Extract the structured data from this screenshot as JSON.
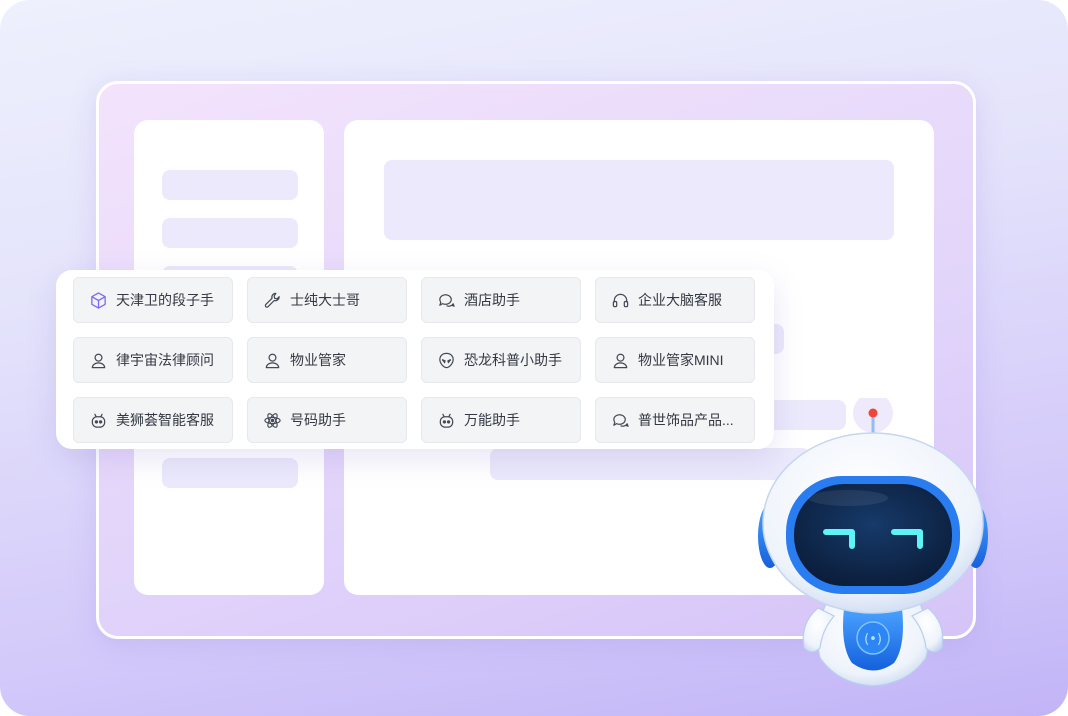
{
  "menu": {
    "items": [
      {
        "label": "天津卫的段子手",
        "icon": "cube-icon"
      },
      {
        "label": "士纯大士哥",
        "icon": "wrench-icon"
      },
      {
        "label": "酒店助手",
        "icon": "chat-bubbles-icon"
      },
      {
        "label": "企业大脑客服",
        "icon": "headset-icon"
      },
      {
        "label": "律宇宙法律顾问",
        "icon": "person-icon"
      },
      {
        "label": "物业管家",
        "icon": "person-icon"
      },
      {
        "label": "恐龙科普小助手",
        "icon": "alien-icon"
      },
      {
        "label": "物业管家MINI",
        "icon": "person-icon"
      },
      {
        "label": "美狮荟智能客服",
        "icon": "robot-head-icon"
      },
      {
        "label": "号码助手",
        "icon": "atom-icon"
      },
      {
        "label": "万能助手",
        "icon": "robot-head-icon"
      },
      {
        "label": "普世饰品产品...",
        "icon": "chat-bubbles-icon"
      }
    ]
  },
  "colors": {
    "accent": "#7b6cf6",
    "robot_blue": "#1e7bf0",
    "robot_eye": "#5ef3f5",
    "placeholder": "#ebe9fb"
  }
}
